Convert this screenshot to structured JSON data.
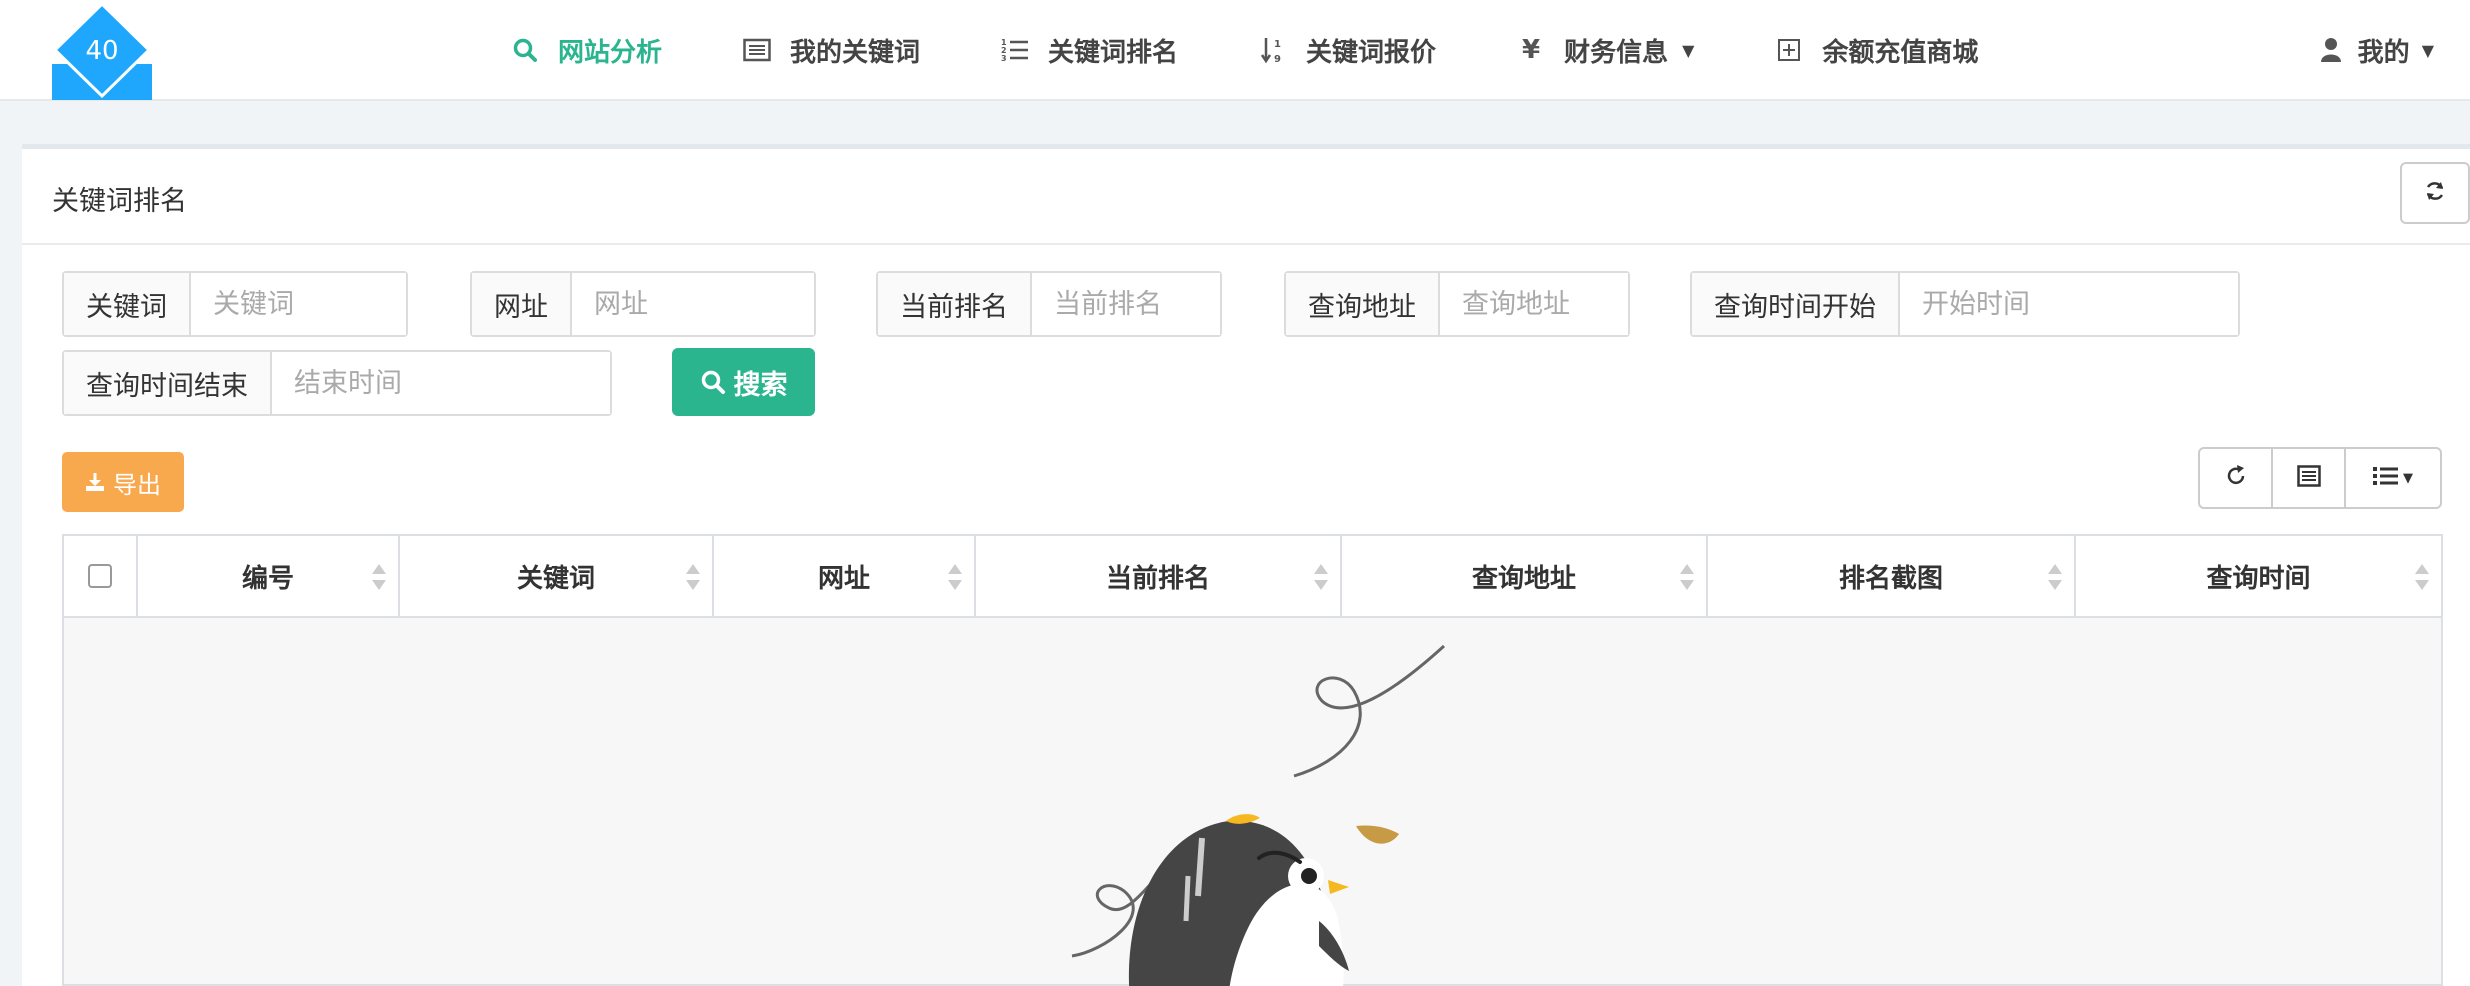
{
  "brand": {
    "logo_number": "40",
    "logo_color": "#1ea7fd"
  },
  "nav": {
    "items": [
      {
        "label": "网站分析",
        "icon": "search-icon",
        "active": true
      },
      {
        "label": "我的关键词",
        "icon": "list-alt-icon",
        "active": false
      },
      {
        "label": "关键词排名",
        "icon": "list-ol-icon",
        "active": false
      },
      {
        "label": "关键词报价",
        "icon": "sort-numeric-icon",
        "active": false
      },
      {
        "label": "财务信息",
        "icon": "yen-icon",
        "active": false,
        "dropdown": true
      },
      {
        "label": "余额充值商城",
        "icon": "plus-square-icon",
        "active": false
      }
    ],
    "user_label": "我的",
    "accent_color": "#2bb58f"
  },
  "panel": {
    "title": "关键词排名"
  },
  "search": {
    "fields": [
      {
        "label": "关键词",
        "placeholder": "关键词"
      },
      {
        "label": "网址",
        "placeholder": "网址"
      },
      {
        "label": "当前排名",
        "placeholder": "当前排名"
      },
      {
        "label": "查询地址",
        "placeholder": "查询地址"
      },
      {
        "label": "查询时间开始",
        "placeholder": "开始时间"
      },
      {
        "label": "查询时间结束",
        "placeholder": "结束时间"
      }
    ],
    "button_label": "搜索"
  },
  "toolbar": {
    "export_label": "导出",
    "export_color": "#f9a94d"
  },
  "table": {
    "columns": [
      "编号",
      "关键词",
      "网址",
      "当前排名",
      "查询地址",
      "排名截图",
      "查询时间"
    ],
    "rows": []
  }
}
